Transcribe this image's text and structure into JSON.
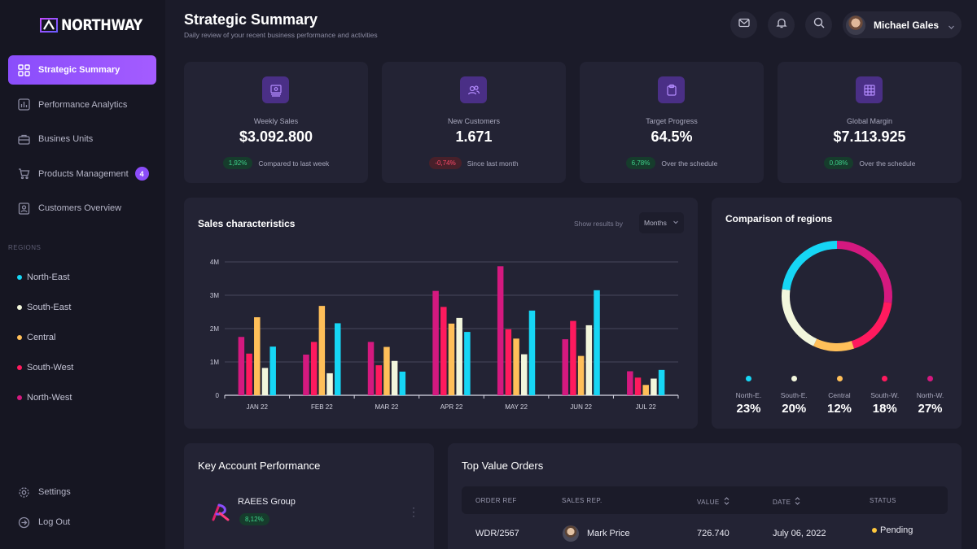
{
  "brand": {
    "name": "NORTHWAY"
  },
  "nav": {
    "items": [
      {
        "label": "Strategic Summary",
        "icon": "grid-icon"
      },
      {
        "label": "Performance Analytics",
        "icon": "chart-icon"
      },
      {
        "label": "Busines Units",
        "icon": "briefcase-icon"
      },
      {
        "label": "Products Management",
        "icon": "cart-icon",
        "badge": "4"
      },
      {
        "label": "Customers Overview",
        "icon": "user-card-icon"
      }
    ],
    "regions_title": "REGIONS",
    "regions": [
      {
        "label": "North-East",
        "color": "#16d6f5"
      },
      {
        "label": "South-East",
        "color": "#f2f6dc"
      },
      {
        "label": "Central",
        "color": "#ffbf59"
      },
      {
        "label": "South-West",
        "color": "#ff1a5e"
      },
      {
        "label": "North-West",
        "color": "#d4197f"
      }
    ],
    "settings": "Settings",
    "logout": "Log Out"
  },
  "header": {
    "title": "Strategic Summary",
    "subtitle": "Daily review of your recent business performance and activities",
    "user": "Michael Gales"
  },
  "stats": [
    {
      "label": "Weekly Sales",
      "value": "$3.092.800",
      "change": "1,92%",
      "trend": "up",
      "note": "Compared to last week",
      "icon": "sales-icon"
    },
    {
      "label": "New Customers",
      "value": "1.671",
      "change": "-0,74%",
      "trend": "down",
      "note": "Since last month",
      "icon": "users-icon"
    },
    {
      "label": "Target Progress",
      "value": "64.5%",
      "change": "6,78%",
      "trend": "up",
      "note": "Over the schedule",
      "icon": "clipboard-icon"
    },
    {
      "label": "Global Margin",
      "value": "$7.113.925",
      "change": "0,08%",
      "trend": "up",
      "note": "Over the schedule",
      "icon": "table-icon"
    }
  ],
  "sales": {
    "title": "Sales characteristics",
    "show_label": "Show results by",
    "period": "Months"
  },
  "chart_data": [
    {
      "type": "bar",
      "title": "Sales characteristics",
      "categories": [
        "JAN 22",
        "FEB 22",
        "MAR 22",
        "APR 22",
        "MAY 22",
        "JUN 22",
        "JUL 22"
      ],
      "yticks": [
        "0",
        "1M",
        "2M",
        "3M",
        "4M"
      ],
      "ylim": [
        0,
        4000000
      ],
      "grid": true,
      "series": [
        {
          "name": "North-West",
          "color": "#d4197f",
          "values": [
            1750000,
            1220000,
            1600000,
            3130000,
            3870000,
            1680000,
            720000
          ]
        },
        {
          "name": "South-West",
          "color": "#ff1a5e",
          "values": [
            1250000,
            1600000,
            900000,
            2650000,
            1980000,
            2230000,
            530000
          ]
        },
        {
          "name": "Central",
          "color": "#ffbf59",
          "values": [
            2340000,
            2680000,
            1450000,
            2150000,
            1700000,
            1180000,
            310000
          ]
        },
        {
          "name": "South-East",
          "color": "#f2f6dc",
          "values": [
            820000,
            660000,
            1030000,
            2320000,
            1230000,
            2100000,
            500000
          ]
        },
        {
          "name": "North-East",
          "color": "#16d6f5",
          "values": [
            1460000,
            2160000,
            710000,
            1900000,
            2540000,
            3150000,
            760000
          ]
        }
      ]
    },
    {
      "type": "pie",
      "title": "Comparison of regions",
      "categories": [
        "North-E.",
        "South-E.",
        "Central",
        "South-W.",
        "North-W."
      ],
      "values": [
        23,
        20,
        12,
        18,
        27
      ],
      "labels": [
        "23%",
        "20%",
        "12%",
        "18%",
        "27%"
      ],
      "colors": [
        "#16d6f5",
        "#f2f6dc",
        "#ffbf59",
        "#ff1a5e",
        "#d4197f"
      ]
    }
  ],
  "regions_card": {
    "title": "Comparison of regions"
  },
  "key_accounts": {
    "title": "Key Account Performance",
    "items": [
      {
        "name": "RAEES Group",
        "change": "8,12%"
      }
    ]
  },
  "orders": {
    "title": "Top Value Orders",
    "columns": [
      "ORDER REF",
      "SALES REP.",
      "VALUE",
      "DATE",
      "STATUS"
    ],
    "rows": [
      {
        "ref": "WDR/2567",
        "rep": "Mark Price",
        "value": "726.740",
        "date": "July 06, 2022",
        "status": "Pending",
        "status_color": "#ffc83d"
      }
    ]
  }
}
